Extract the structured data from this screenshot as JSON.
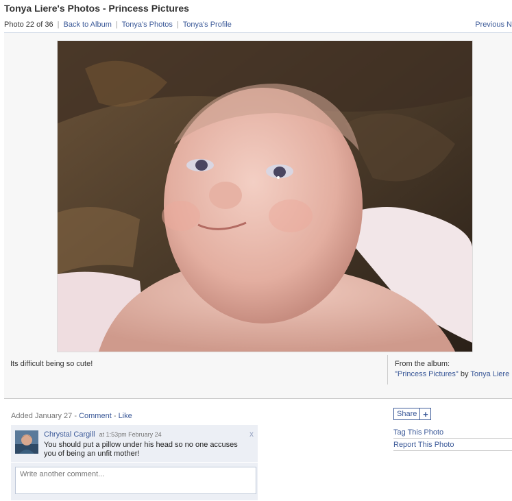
{
  "header": {
    "title": "Tonya Liere's Photos - Princess Pictures",
    "photo_count": "Photo 22 of 36",
    "back_to_album": "Back to Album",
    "owner_photos": "Tonya's Photos",
    "owner_profile": "Tonya's Profile",
    "separator": "|",
    "previous": "Previous",
    "next": "N"
  },
  "photo": {
    "caption": "Its difficult being so cute!",
    "album_from": "From the album:",
    "album_name": "\"Princess Pictures\"",
    "album_by": "by",
    "album_owner": "Tonya Liere"
  },
  "activity": {
    "added": "Added January 27 -",
    "comment_link": "Comment",
    "dash": "-",
    "like_link": "Like"
  },
  "comments": [
    {
      "author": "Chrystal Cargill",
      "time": "at 1:53pm February 24",
      "text": "You should put a pillow under his head so no one accuses you of being an unfit mother!",
      "close": "x"
    }
  ],
  "comment_input": {
    "placeholder": "Write another comment..."
  },
  "sidebar": {
    "share_label": "Share",
    "share_plus": "+",
    "tag_photo": "Tag This Photo",
    "report_photo": "Report This Photo"
  },
  "colors": {
    "link": "#3b5998",
    "comment_bg": "#eceff5",
    "photo_bg": "#f7f7f7"
  }
}
